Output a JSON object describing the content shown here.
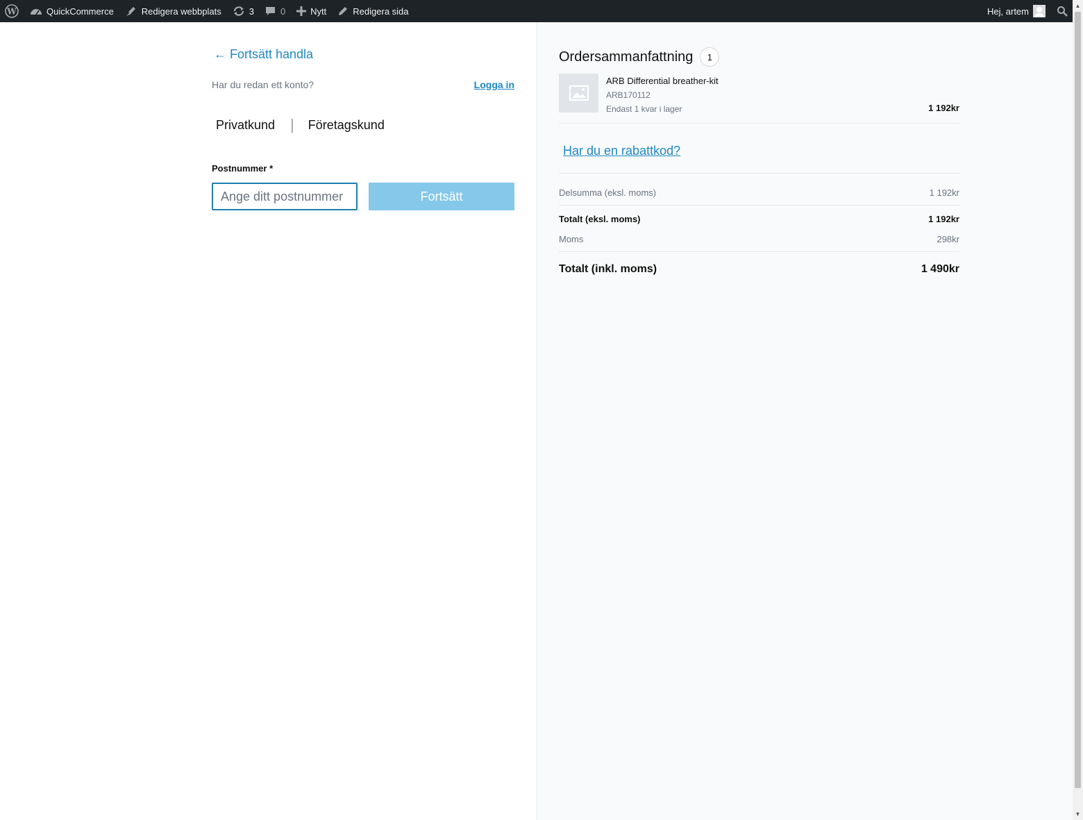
{
  "adminbar": {
    "site_name": "QuickCommerce",
    "edit_site": "Redigera webbplats",
    "updates_count": "3",
    "comments_count": "0",
    "new_label": "Nytt",
    "edit_page": "Redigera sida",
    "greeting": "Hej, artem"
  },
  "checkout": {
    "back_link": "← Fortsätt handla",
    "account_question": "Har du redan ett konto?",
    "login_link": "Logga in",
    "tab_private": "Privatkund",
    "tab_separator": "|",
    "tab_business": "Företagskund",
    "zip_label": "Postnummer *",
    "zip_placeholder": "Ange ditt postnummer",
    "zip_value": "",
    "continue_button": "Fortsätt"
  },
  "summary": {
    "title": "Ordersammanfattning",
    "item_count": "1",
    "items": [
      {
        "name": "ARB Differential breather-kit",
        "sku": "ARB170112",
        "stock": "Endast 1 kvar i lager",
        "price": "1 192kr"
      }
    ],
    "coupon_link": "Har du en rabattkod?",
    "subtotal_label": "Delsumma (eksl. moms)",
    "subtotal_value": "1 192kr",
    "total_ex_label": "Totalt (eksl. moms)",
    "total_ex_value": "1 192kr",
    "vat_label": "Moms",
    "vat_value": "298kr",
    "grand_total_label": "Totalt (inkl. moms)",
    "grand_total_value": "1 490kr"
  },
  "colors": {
    "link": "#1e88c5",
    "button_disabled": "#85c8ea",
    "adminbar_bg": "#1d2327",
    "summary_bg": "#f9fafb"
  }
}
